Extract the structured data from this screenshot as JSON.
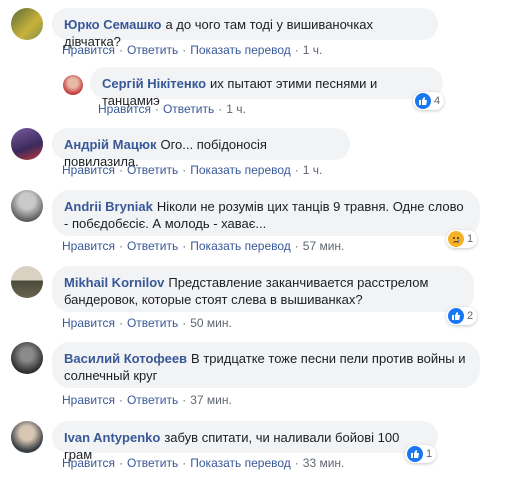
{
  "labels": {
    "like": "Нравится",
    "reply": "Ответить",
    "translate": "Показать перевод",
    "sep": "·"
  },
  "comments": [
    {
      "author": "Юрко Семашко",
      "text": "а до чого там тоді у вишиваночках дівчатка?",
      "time": "1 ч.",
      "translate": true
    },
    {
      "author": "Сергій Нікітенко",
      "text": "их пытают этими песнями и танцамиэ",
      "time": "1 ч.",
      "translate": false,
      "reaction": {
        "type": "like",
        "count": "4"
      }
    },
    {
      "author": "Андрій Мацюк",
      "text": "Ого... побідоносія повилазила.",
      "time": "1 ч.",
      "translate": true
    },
    {
      "author": "Andrii Bryniak",
      "text": "Ніколи не розумів цих танців 9 травня. Одне слово - побєдобєсіє. А молодь - хаває...",
      "time": "57 мин.",
      "translate": true,
      "reaction": {
        "type": "sad",
        "count": "1"
      }
    },
    {
      "author": "Mikhail Kornilov",
      "text": "Представление заканчивается расстрелом бандеровок, которые стоят слева в вышиванках?",
      "time": "50 мин.",
      "translate": false,
      "reaction": {
        "type": "like",
        "count": "2"
      }
    },
    {
      "author": "Василий Котофеев",
      "text": "В тридцатке тоже песни пели против войны и солнечный круг",
      "time": "37 мин.",
      "translate": false
    },
    {
      "author": "Ivan Antypenko",
      "text": "забув спитати, чи наливали бойові 100 грам",
      "time": "33 мин.",
      "translate": true,
      "reaction": {
        "type": "like",
        "count": "1"
      }
    }
  ],
  "colors": {
    "link": "#385898",
    "bubble": "#f2f3f5",
    "meta": "#606770",
    "like": "#1877f2",
    "sad": "#f7b125"
  }
}
